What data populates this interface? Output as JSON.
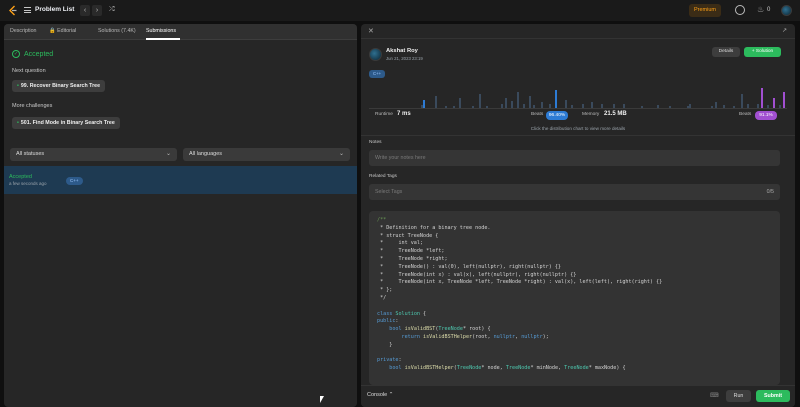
{
  "header": {
    "title": "Problem List",
    "premium_label": "Premium",
    "streak_count": "0",
    "icons": [
      "leetcode-logo-icon",
      "list-icon",
      "chevron-left-icon",
      "chevron-right-icon",
      "shuffle-icon",
      "timer-icon",
      "fire-icon",
      "avatar"
    ]
  },
  "left_panel": {
    "tabs": [
      {
        "label": "Description",
        "active": false
      },
      {
        "label": "Editorial",
        "active": false
      },
      {
        "label": "Solutions (7.4K)",
        "active": false
      },
      {
        "label": "Submissions",
        "active": true
      }
    ],
    "status": "Accepted",
    "next_question_label": "Next question",
    "next_question": "99. Recover Binary Search Tree",
    "more_challenges_label": "More challenges",
    "more_challenge": "501. Find Mode in Binary Search Tree",
    "filters": {
      "status_select": "All statuses",
      "language_select": "All languages"
    },
    "submissions": [
      {
        "status": "Accepted",
        "time": "a few seconds ago",
        "language": "C++"
      }
    ]
  },
  "right_panel": {
    "user": {
      "name": "Akshat Roy",
      "date": "Jun 21, 2023 23:19"
    },
    "details_label": "Details",
    "solution_label": "+ Solution",
    "language_tag": "C++",
    "runtime": {
      "label": "Runtime",
      "value": "7 ms",
      "beats_label": "Beats",
      "beats": "96.40%"
    },
    "memory": {
      "label": "Memory",
      "value": "21.5 MB",
      "beats_label": "Beats",
      "beats": "91.1%"
    },
    "chart_hint": "Click the distribution chart to view more details",
    "notes_label": "Notes",
    "notes_placeholder": "Write your notes here",
    "tags_label": "Related Tags",
    "tags_placeholder": "Select Tags",
    "tags_count": "0/5",
    "colors": {
      "accent_green": "#2cbb5d",
      "runtime_blue": "#2d7bd4",
      "memory_purple": "#a14fd1",
      "premium_orange": "#ffa116"
    },
    "code_lines": [
      "/**",
      " * Definition for a binary tree node.",
      " * struct TreeNode {",
      " *     int val;",
      " *     TreeNode *left;",
      " *     TreeNode *right;",
      " *     TreeNode() : val(0), left(nullptr), right(nullptr) {}",
      " *     TreeNode(int x) : val(x), left(nullptr), right(nullptr) {}",
      " *     TreeNode(int x, TreeNode *left, TreeNode *right) : val(x), left(left), right(right) {}",
      " * };",
      " */",
      "",
      "class Solution {",
      "public:",
      "    bool isValidBST(TreeNode* root) {",
      "        return isValidBSTHelper(root, nullptr, nullptr);",
      "    }",
      "",
      "private:",
      "    bool isValidBSTHelper(TreeNode* node, TreeNode* minNode, TreeNode* maxNode) {"
    ],
    "console_label": "Console",
    "run_label": "Run",
    "submit_label": "Submit"
  }
}
